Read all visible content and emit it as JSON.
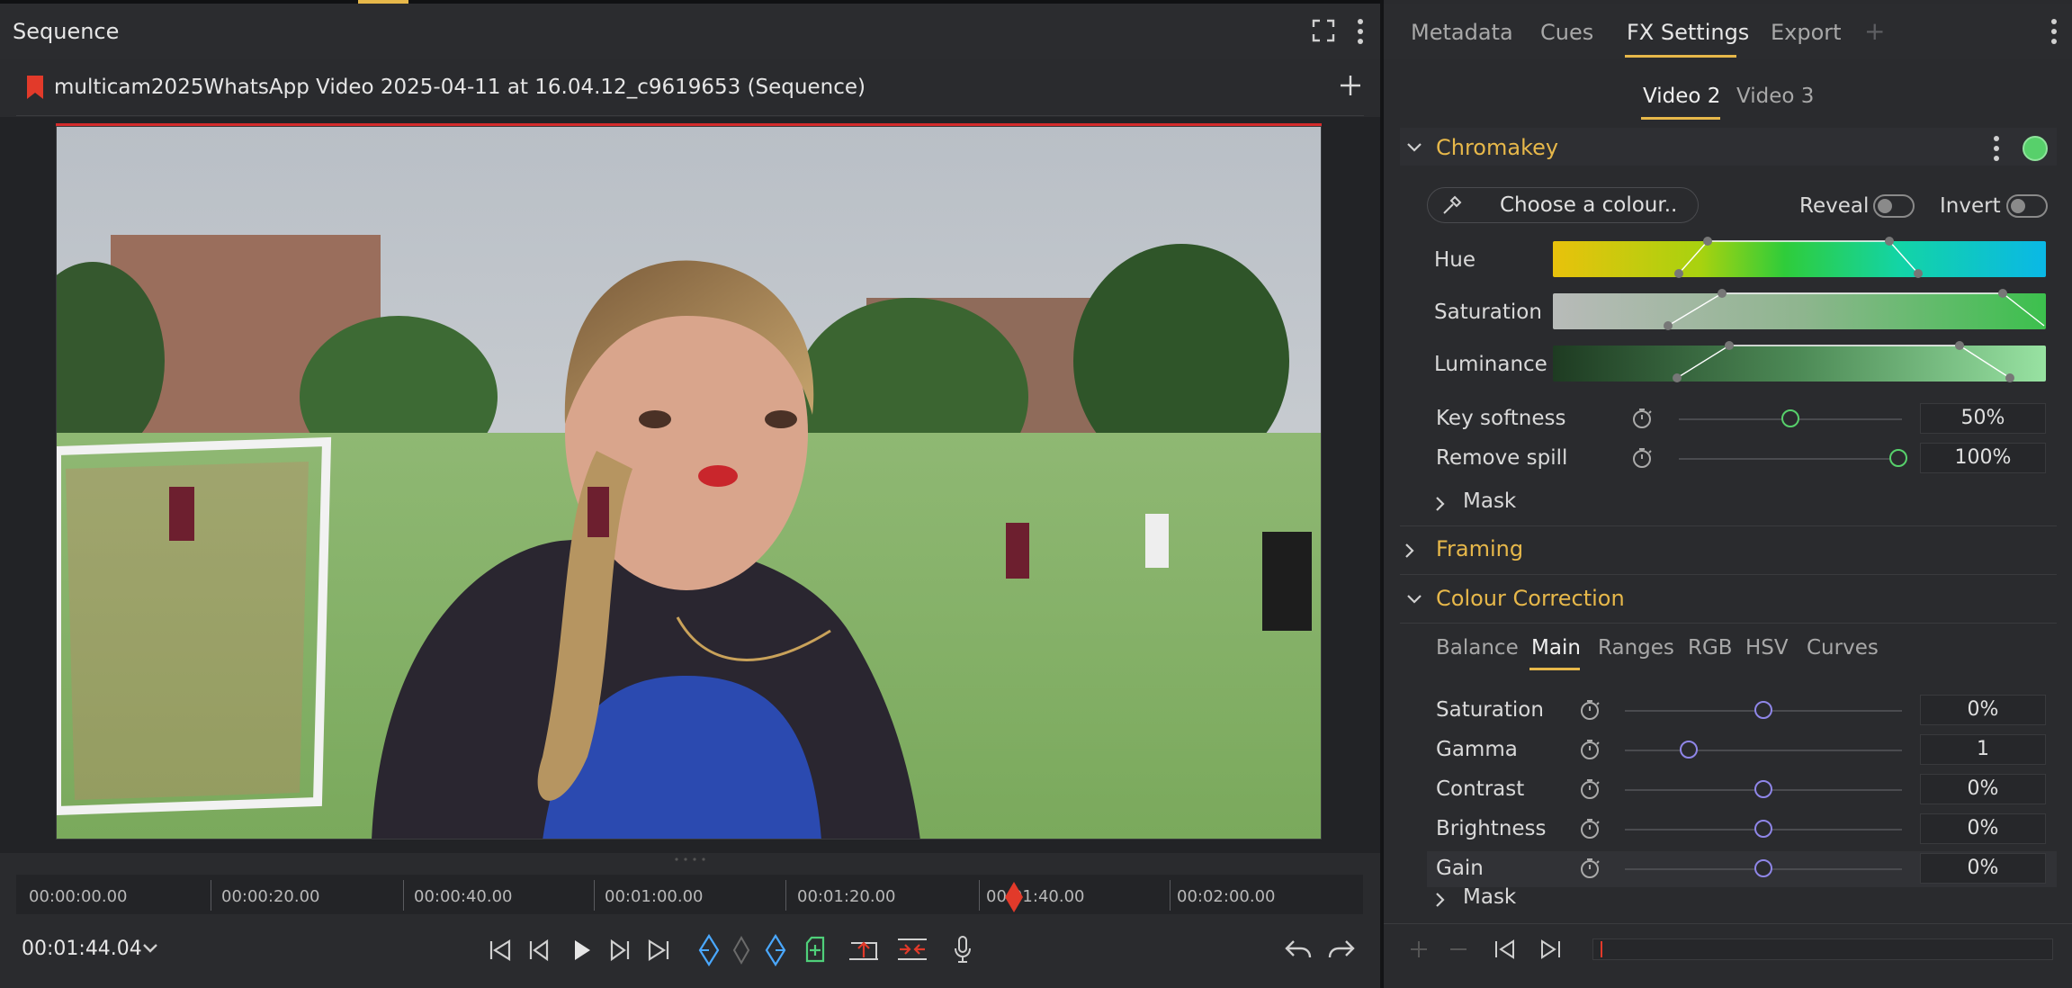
{
  "left_panel": {
    "title": "Sequence",
    "sequence_name": "multicam2025WhatsApp Video 2025-04-11 at 16.04.12_c9619653 (Sequence)",
    "timecode": "00:01:44.04",
    "timeline_labels": [
      "00:00:00.00",
      "00:00:20.00",
      "00:00:40.00",
      "00:01:00.00",
      "00:01:20.00",
      "00:01:40.00",
      "00:02:00.00"
    ],
    "playhead_position": 0.741
  },
  "right_panel": {
    "tabs": [
      "Metadata",
      "Cues",
      "FX Settings",
      "Export"
    ],
    "active_tab": "FX Settings",
    "add_tab": "+",
    "video_tabs": [
      "Video 2",
      "Video 3"
    ],
    "chromakey": {
      "title": "Chromakey",
      "choose_colour": "Choose a colour..",
      "reveal": "Reveal",
      "invert": "Invert",
      "hue": "Hue",
      "saturation": "Saturation",
      "luminance": "Luminance",
      "key_softness": "Key softness",
      "key_softness_value": "50%",
      "key_softness_level": 0.5,
      "remove_spill": "Remove spill",
      "remove_spill_value": "100%",
      "remove_spill_level": 1.0,
      "mask": "Mask"
    },
    "framing": "Framing",
    "colour_correction": {
      "title": "Colour Correction",
      "subtabs": [
        "Balance",
        "Main",
        "Ranges",
        "RGB",
        "HSV",
        "Curves"
      ],
      "active_subtab": "Main",
      "rows": [
        {
          "label": "Saturation",
          "value": "0%",
          "level": 0.5
        },
        {
          "label": "Gamma",
          "value": "1",
          "level": 0.23
        },
        {
          "label": "Contrast",
          "value": "0%",
          "level": 0.5
        },
        {
          "label": "Brightness",
          "value": "0%",
          "level": 0.5
        },
        {
          "label": "Gain",
          "value": "0%",
          "level": 0.5
        }
      ],
      "mask": "Mask"
    }
  },
  "colors": {
    "accent": "#e7b84a",
    "green": "#57d06b",
    "knob": "#8f86e8",
    "red": "#e23a2a"
  }
}
